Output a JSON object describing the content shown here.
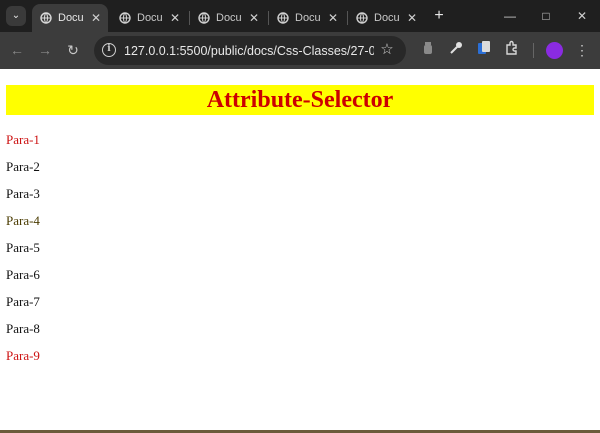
{
  "tabs": [
    {
      "title": "Docu",
      "active": true
    },
    {
      "title": "Docu",
      "active": false
    },
    {
      "title": "Docu",
      "active": false
    },
    {
      "title": "Docu",
      "active": false
    },
    {
      "title": "Docu",
      "active": false
    }
  ],
  "toolbar": {
    "url": "127.0.0.1:5500/public/docs/Css-Classes/27-08-20..."
  },
  "page": {
    "heading": "Attribute-Selector",
    "paragraphs": [
      {
        "text": "Para-1",
        "color": "#cc1111"
      },
      {
        "text": "Para-2",
        "color": "#111111"
      },
      {
        "text": "Para-3",
        "color": "#111111"
      },
      {
        "text": "Para-4",
        "color": "#4a3b00"
      },
      {
        "text": "Para-5",
        "color": "#111111"
      },
      {
        "text": "Para-6",
        "color": "#111111"
      },
      {
        "text": "Para-7",
        "color": "#111111"
      },
      {
        "text": "Para-8",
        "color": "#111111"
      },
      {
        "text": "Para-9",
        "color": "#cc1111"
      }
    ]
  },
  "colors": {
    "heading_bg": "#ffff00",
    "heading_text": "#cc0000",
    "profile": "#8a2be2"
  }
}
